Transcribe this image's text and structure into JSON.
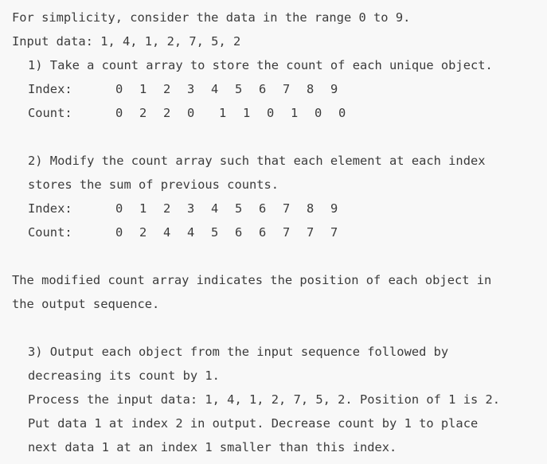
{
  "intro": {
    "range_line": "For simplicity, consider the data in the range 0 to 9.",
    "input_line": "Input data: 1, 4, 1, 2, 7, 5, 2"
  },
  "step1": {
    "text": "1) Take a count array to store the count of each unique object.",
    "index_label": "Index:",
    "index_values": [
      "0",
      "1",
      "2",
      "3",
      "4",
      "5",
      "6",
      "7",
      "8",
      "9"
    ],
    "count_label": "Count:",
    "count_values": [
      "0",
      "2",
      "2",
      "0",
      "1",
      "1",
      "0",
      "1",
      "0",
      "0"
    ]
  },
  "step2": {
    "line1": "2) Modify the count array such that each element at each index",
    "line2": "stores the sum of previous counts.",
    "index_label": "Index:",
    "index_values": [
      "0",
      "1",
      "2",
      "3",
      "4",
      "5",
      "6",
      "7",
      "8",
      "9"
    ],
    "count_label": "Count:",
    "count_values": [
      "0",
      "2",
      "4",
      "4",
      "5",
      "6",
      "6",
      "7",
      "7",
      "7"
    ]
  },
  "note": {
    "line1": "The modified count array indicates the position of each object in",
    "line2": "the output sequence."
  },
  "step3": {
    "line1": "3) Output each object from the input sequence followed by",
    "line2": "decreasing its count by 1.",
    "line3": "Process the input data: 1, 4, 1, 2, 7, 5, 2. Position of 1 is 2.",
    "line4": "Put data 1 at index 2 in output. Decrease count by 1 to place",
    "line5": "next data 1 at an index 1 smaller than this index."
  }
}
